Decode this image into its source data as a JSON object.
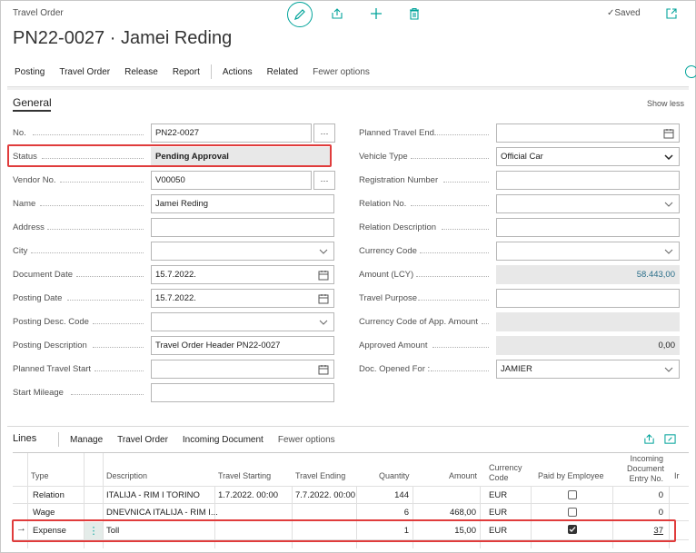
{
  "header": {
    "page_type": "Travel Order",
    "title": "PN22-0027 · Jamei Reding",
    "saved_label": "Saved"
  },
  "actions": {
    "items": [
      "Posting",
      "Travel Order",
      "Release",
      "Report",
      "Actions",
      "Related",
      "Fewer options"
    ]
  },
  "general": {
    "title": "General",
    "show_less": "Show less",
    "left": [
      {
        "label": "No.",
        "value": "PN22-0027"
      },
      {
        "label": "Status",
        "value": "Pending Approval"
      },
      {
        "label": "Vendor No.",
        "value": "V00050"
      },
      {
        "label": "Name",
        "value": "Jamei Reding"
      },
      {
        "label": "Address",
        "value": ""
      },
      {
        "label": "City",
        "value": ""
      },
      {
        "label": "Document Date",
        "value": "15.7.2022."
      },
      {
        "label": "Posting Date",
        "value": "15.7.2022."
      },
      {
        "label": "Posting Desc. Code",
        "value": ""
      },
      {
        "label": "Posting Description",
        "value": "Travel Order Header PN22-0027"
      },
      {
        "label": "Planned Travel Start",
        "value": ""
      },
      {
        "label": "Start Mileage",
        "value": ""
      }
    ],
    "right": [
      {
        "label": "Planned Travel End",
        "value": ""
      },
      {
        "label": "Vehicle Type",
        "value": "Official Car"
      },
      {
        "label": "Registration Number",
        "value": ""
      },
      {
        "label": "Relation No.",
        "value": ""
      },
      {
        "label": "Relation Description",
        "value": ""
      },
      {
        "label": "Currency Code",
        "value": ""
      },
      {
        "label": "Amount (LCY)",
        "value": "58.443,00"
      },
      {
        "label": "Travel Purpose",
        "value": ""
      },
      {
        "label": "Currency Code of App. Amount",
        "value": ""
      },
      {
        "label": "Approved Amount",
        "value": "0,00"
      },
      {
        "label": "Doc. Opened For :",
        "value": "JAMIER"
      }
    ]
  },
  "lines": {
    "title": "Lines",
    "menu": [
      "Manage",
      "Travel Order",
      "Incoming Document",
      "Fewer options"
    ],
    "columns": {
      "type": "Type",
      "description": "Description",
      "travel_starting": "Travel Starting",
      "travel_ending": "Travel Ending",
      "quantity": "Quantity",
      "amount": "Amount",
      "currency_1": "Currency",
      "currency_2": "Code",
      "paid": "Paid by Employee",
      "inc_1": "Incoming",
      "inc_2": "Document",
      "inc_3": "Entry No.",
      "extra": "Ir"
    },
    "rows": [
      {
        "type": "Relation",
        "description": "ITALIJA - RIM I TORINO",
        "start": "1.7.2022. 00:00",
        "end": "7.7.2022. 00:00",
        "quantity": "144",
        "amount": "",
        "currency": "EUR",
        "paid": false,
        "entry": "0"
      },
      {
        "type": "Wage",
        "description": "DNEVNICA ITALIJA - RIM I...",
        "start": "",
        "end": "",
        "quantity": "6",
        "amount": "468,00",
        "currency": "EUR",
        "paid": false,
        "entry": "0"
      },
      {
        "type": "Expense",
        "description": "Toll",
        "start": "",
        "end": "",
        "quantity": "1",
        "amount": "15,00",
        "currency": "EUR",
        "paid": true,
        "entry": "37"
      }
    ]
  },
  "colors": {
    "accent": "#00a39a",
    "highlight": "#e03c3c"
  }
}
